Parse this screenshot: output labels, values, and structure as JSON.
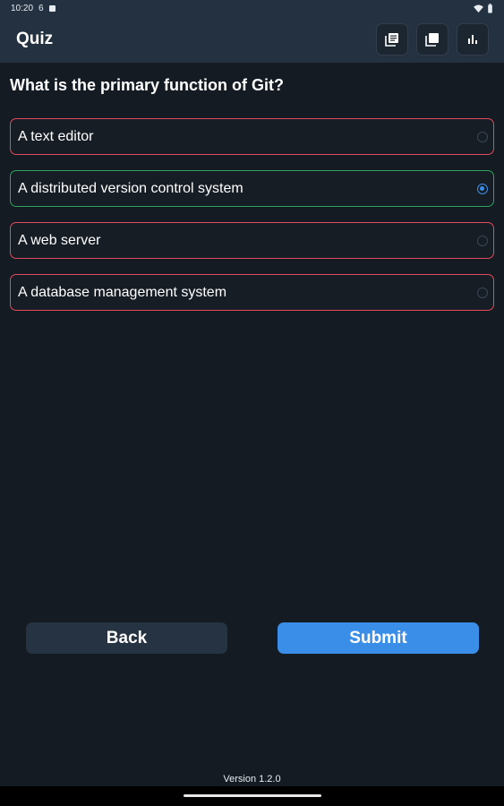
{
  "status": {
    "time": "10:20",
    "extra_icon": "6",
    "wifi_icon": "wifi-icon",
    "battery_icon": "battery-icon"
  },
  "app_bar": {
    "title": "Quiz",
    "actions": [
      "library-icon",
      "copy-icon",
      "bar-chart-icon"
    ]
  },
  "quiz": {
    "question": "What is the primary function of Git?",
    "options": [
      {
        "label": "A text editor",
        "state": "incorrect",
        "selected": false
      },
      {
        "label": "A distributed version control system",
        "state": "correct",
        "selected": true
      },
      {
        "label": "A web server",
        "state": "incorrect",
        "selected": false
      },
      {
        "label": "A database management system",
        "state": "incorrect",
        "selected": false
      }
    ]
  },
  "buttons": {
    "back": "Back",
    "submit": "Submit"
  },
  "footer": {
    "version": "Version 1.2.0"
  },
  "colors": {
    "background": "#141b22",
    "app_bar": "#243140",
    "correct": "#2fa35b",
    "incorrect": "#e14c5c",
    "accent": "#3b8ee8"
  }
}
